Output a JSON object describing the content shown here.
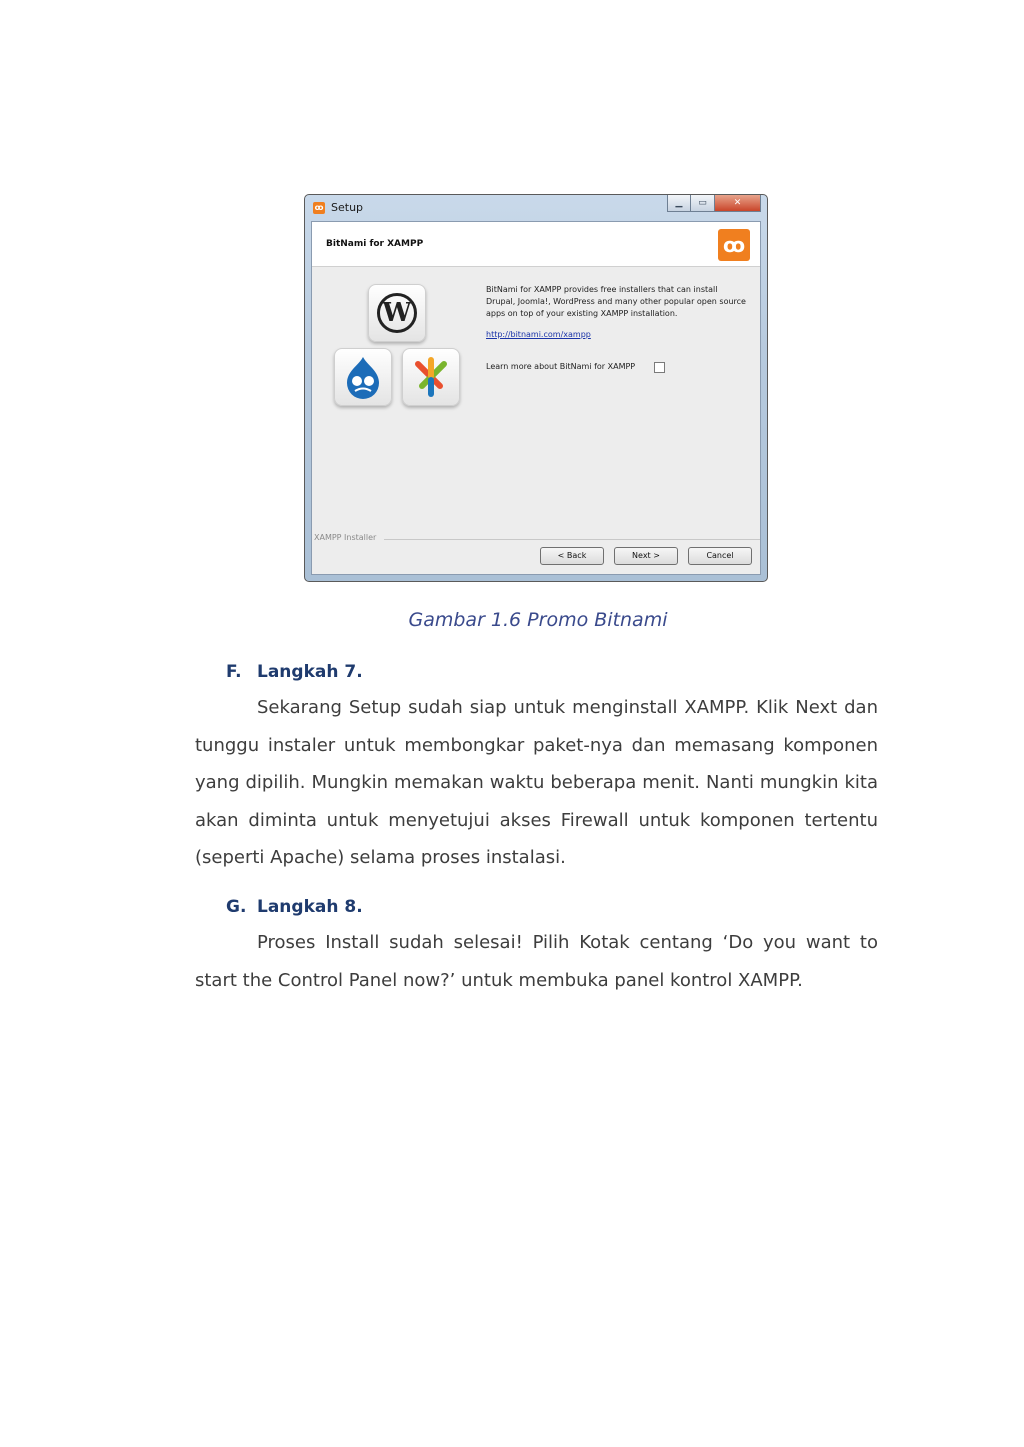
{
  "dialog": {
    "window_title": "Setup",
    "header_title": "BitNami for XAMPP",
    "description": "BitNami for XAMPP provides free installers that can install Drupal, Joomla!, WordPress and many other popular open source apps on top of your existing XAMPP installation.",
    "link": "http://bitnami.com/xampp",
    "learn_more_label": "Learn more about BitNami for XAMPP",
    "learn_more_checked": false,
    "group_label": "XAMPP Installer",
    "buttons": {
      "back": "< Back",
      "next": "Next >",
      "cancel": "Cancel"
    },
    "icons": [
      "xampp-icon",
      "minimize-icon",
      "maximize-icon",
      "close-icon",
      "xampp-logo",
      "wordpress-icon",
      "drupal-icon",
      "joomla-icon"
    ]
  },
  "caption": "Gambar 1.6 Promo Bitnami",
  "sections": [
    {
      "letter": "F.",
      "title": "Langkah 7.",
      "body": "Sekarang Setup sudah siap untuk menginstall XAMPP. Klik Next dan tunggu instaler untuk membongkar paket-nya dan memasang komponen yang dipilih. Mungkin memakan waktu beberapa menit. Nanti mungkin kita akan diminta untuk menyetujui akses Firewall untuk komponen tertentu (seperti Apache) selama proses instalasi."
    },
    {
      "letter": "G.",
      "title": "Langkah 8.",
      "body": "Proses Install sudah selesai! Pilih Kotak centang ‘Do you want to start the Control Panel now?’ untuk membuka panel kontrol XAMPP."
    }
  ]
}
